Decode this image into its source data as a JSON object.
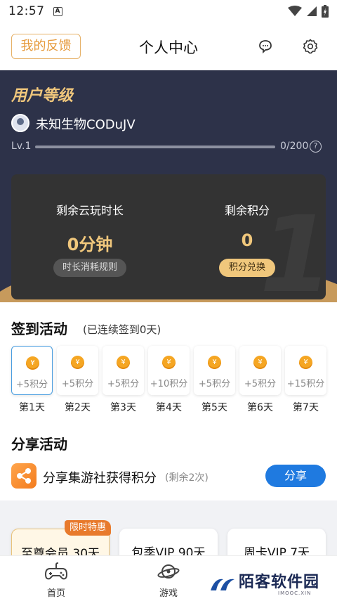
{
  "status": {
    "time": "12:57",
    "sim_label": "A"
  },
  "header": {
    "feedback_label": "我的反馈",
    "title": "个人中心"
  },
  "level": {
    "title": "用户等级",
    "username": "未知生物CODuJV",
    "lv_label": "Lv.1",
    "progress_text": "0/200",
    "progress_fraction": 0,
    "help_symbol": "?"
  },
  "stats": {
    "time_label": "剩余云玩时长",
    "time_value": "0分钟",
    "time_rule_button": "时长消耗规则",
    "points_label": "剩余积分",
    "points_value": "0",
    "exchange_button": "积分兑换"
  },
  "signin": {
    "title": "签到活动",
    "subtitle": "(已连续签到0天)",
    "coin_glyph": "¥",
    "days": [
      {
        "points": "+5积分",
        "label": "第1天",
        "active": true
      },
      {
        "points": "+5积分",
        "label": "第2天",
        "active": false
      },
      {
        "points": "+5积分",
        "label": "第3天",
        "active": false
      },
      {
        "points": "+10积分",
        "label": "第4天",
        "active": false
      },
      {
        "points": "+5积分",
        "label": "第5天",
        "active": false
      },
      {
        "points": "+5积分",
        "label": "第6天",
        "active": false
      },
      {
        "points": "+15积分",
        "label": "第7天",
        "active": false
      }
    ]
  },
  "share": {
    "title": "分享活动",
    "text": "分享集游社获得积分",
    "remaining": "(剩余2次)",
    "button": "分享"
  },
  "vip": {
    "hot_tag": "限时特惠",
    "cards": [
      "至尊会员 30天",
      "包季VIP 90天",
      "周卡VIP 7天"
    ]
  },
  "tabbar": {
    "tabs": [
      {
        "label": "首页",
        "icon": "gamepad-icon"
      },
      {
        "label": "游戏",
        "icon": "planet-icon"
      }
    ]
  },
  "watermark": {
    "text": "陌客软件园",
    "sub": "IMOOC.XIN"
  }
}
